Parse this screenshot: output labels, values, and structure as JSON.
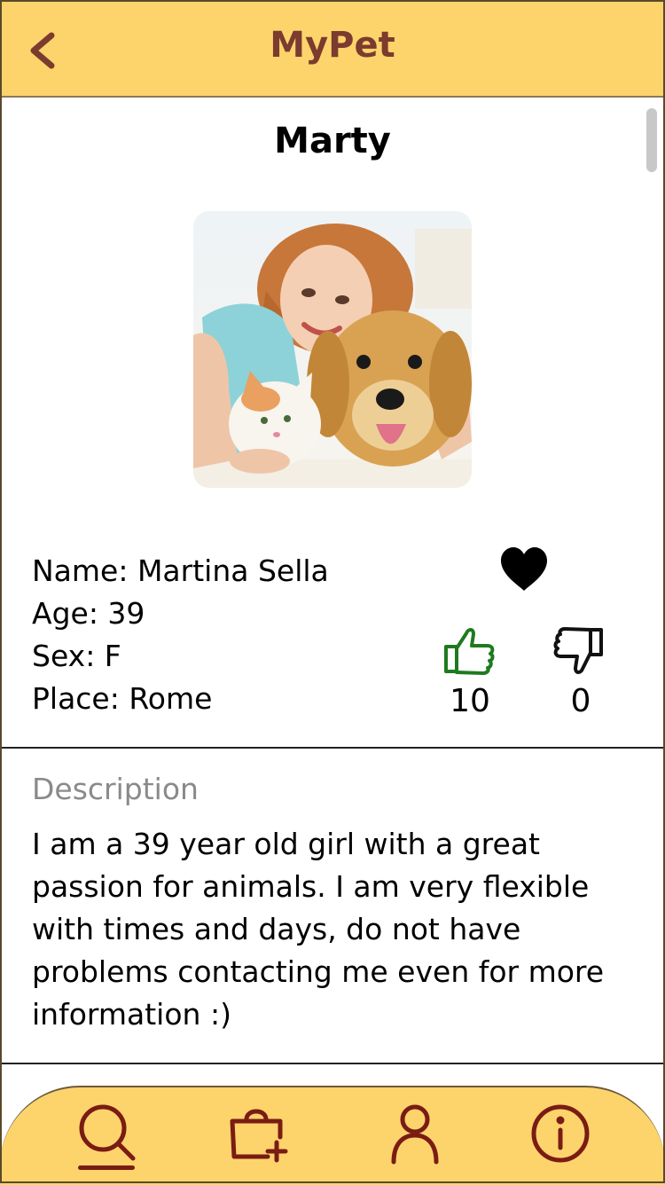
{
  "header": {
    "title": "MyPet",
    "back_icon": "chevron-left-icon"
  },
  "profile": {
    "nickname": "Marty",
    "photo": "woman-with-cat-and-dog-photo",
    "name_line": "Name: Martina Sella",
    "age_line": "Age: 39",
    "sex_line": "Sex: F",
    "place_line": "Place: Rome",
    "favorite_icon": "heart-icon",
    "likes": "10",
    "dislikes": "0"
  },
  "description": {
    "label": "Description",
    "text": "I am a 39 year old girl with a great passion for animals. I am very flexible with times and days, do not have problems contacting me even for more information :)"
  },
  "bottom_nav": {
    "items": [
      "search-icon",
      "add-bag-icon",
      "profile-icon",
      "info-icon"
    ],
    "active": "search-icon"
  },
  "colors": {
    "header_bg": "#fdd46c",
    "title": "#7b3b2e",
    "nav_icon": "#7a1c14",
    "like": "#1f7a1f"
  }
}
